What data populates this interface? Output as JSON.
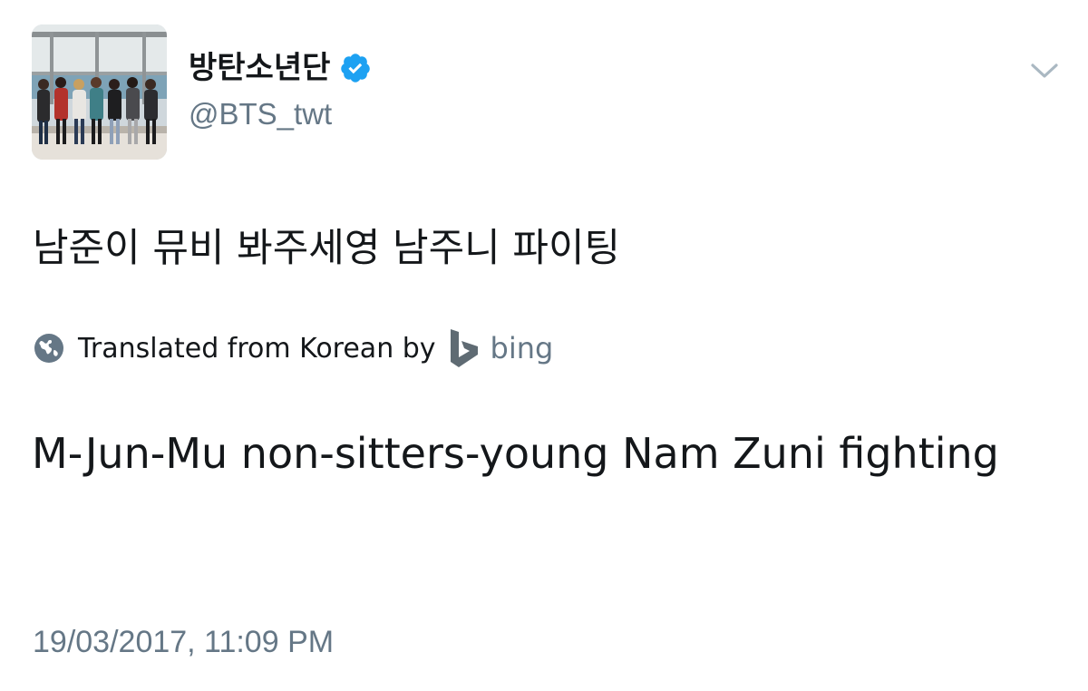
{
  "tweet": {
    "author": {
      "display_name": "방탄소년단",
      "handle": "@BTS_twt",
      "verified": true
    },
    "text": "남준이 뮤비 봐주세영 남주니 파이팅",
    "translation": {
      "label": "Translated from Korean by",
      "provider": "bing",
      "text": "M-Jun-Mu non-sitters-young Nam Zuni fighting"
    },
    "timestamp": "19/03/2017, 11:09 PM"
  },
  "icons": {
    "verified": "verified-badge-icon",
    "menu": "chevron-down-icon",
    "globe": "globe-icon",
    "bing": "bing-logo-icon"
  },
  "colors": {
    "text_primary": "#14171a",
    "text_secondary": "#657786",
    "verified_blue": "#1da1f2",
    "bing_gray": "#5f6b73"
  }
}
